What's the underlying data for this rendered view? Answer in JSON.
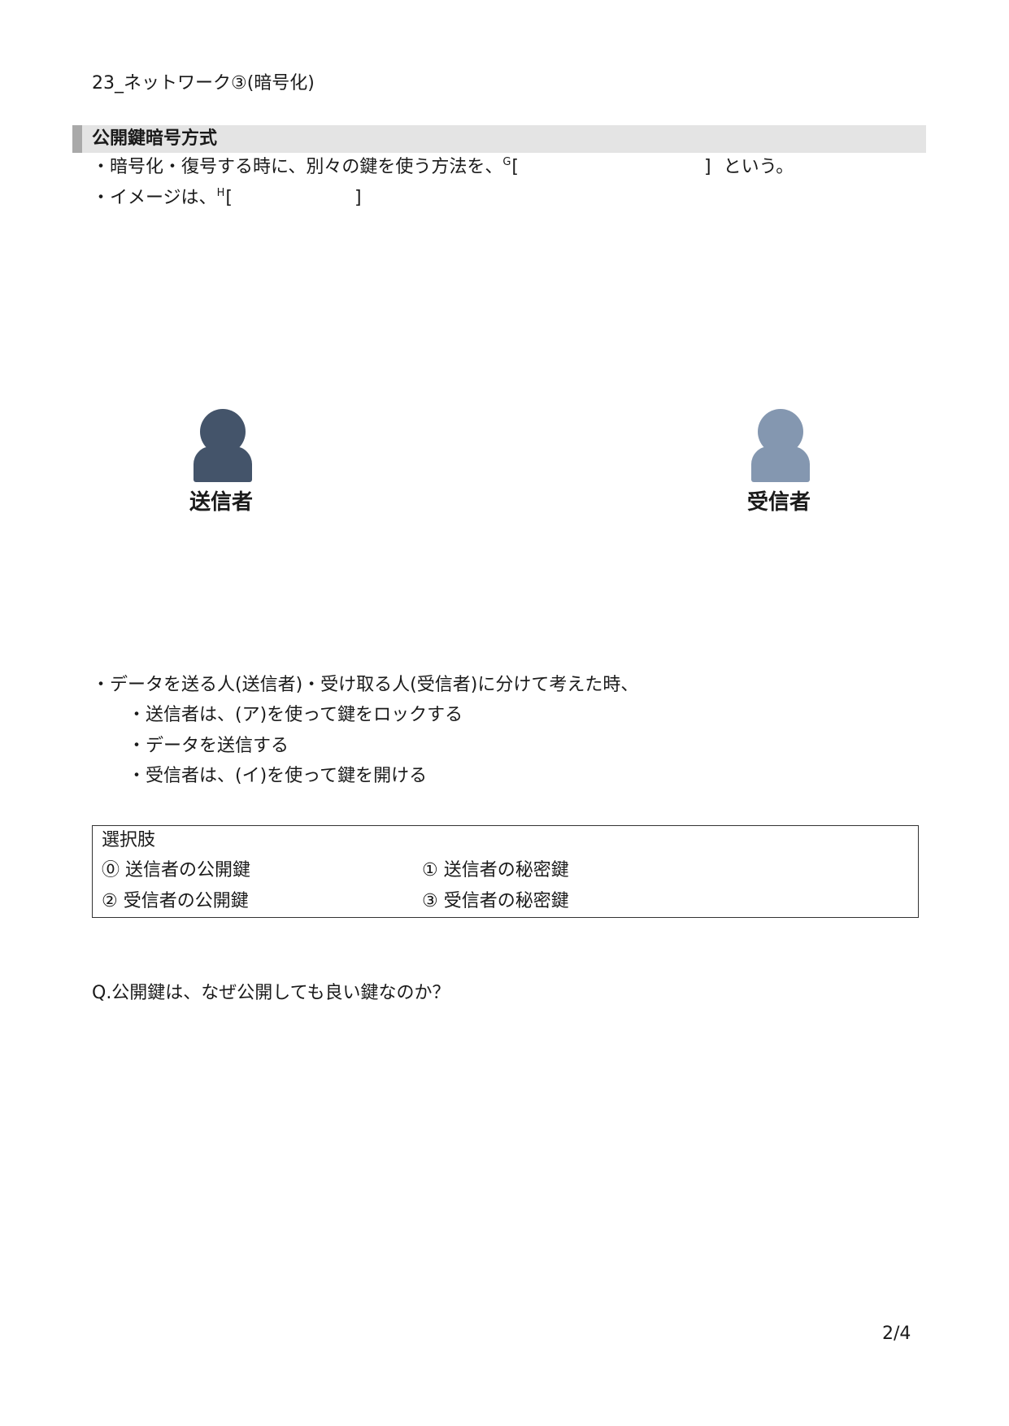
{
  "header": {
    "title": "23_ネットワーク③(暗号化)"
  },
  "section": {
    "title": "公開鍵暗号方式",
    "line1": {
      "prefix": "・暗号化・復号する時に、別々の鍵を使う方法を、",
      "blank_marker": "G",
      "bracket_open": "[",
      "bracket_close": "]",
      "suffix": "という。"
    },
    "line2": {
      "prefix": "・イメージは、",
      "blank_marker": "H",
      "bracket_open": "[",
      "bracket_close": "]"
    }
  },
  "figure": {
    "sender": {
      "label": "送信者",
      "icon": "person-icon",
      "color": "#44546a"
    },
    "receiver": {
      "label": "受信者",
      "icon": "person-icon",
      "color": "#8497b0"
    }
  },
  "steps": {
    "intro": "・データを送る人(送信者)・受け取る人(受信者)に分けて考えた時、",
    "items": [
      "・送信者は、(ア)を使って鍵をロックする",
      "・データを送信する",
      "・受信者は、(イ)を使って鍵を開ける"
    ]
  },
  "choices": {
    "title": "選択肢",
    "items": [
      "⓪ 送信者の公開鍵",
      "① 送信者の秘密鍵",
      "② 受信者の公開鍵",
      "③ 受信者の秘密鍵"
    ]
  },
  "question": "Q.公開鍵は、なぜ公開しても良い鍵なのか？",
  "page_number": "2/4"
}
